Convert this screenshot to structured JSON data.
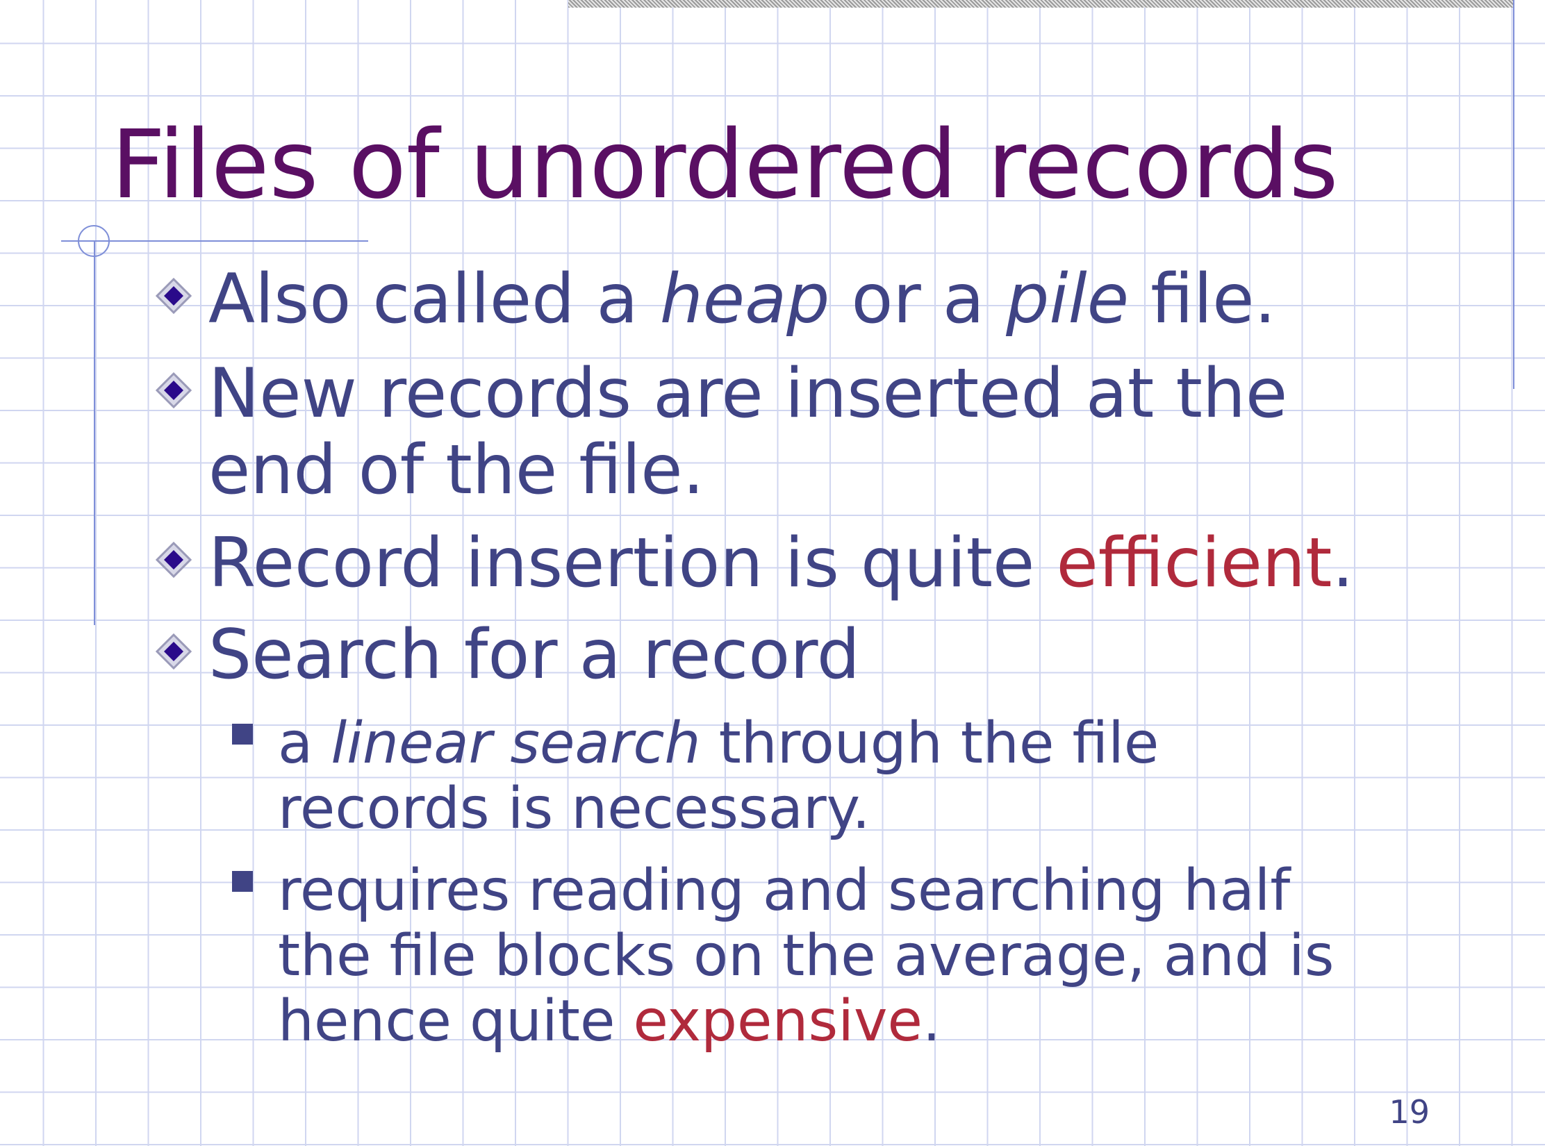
{
  "title": "Files of unordered records",
  "page_number": "19",
  "colors": {
    "title": "#5a0f63",
    "body": "#404485",
    "highlight": "#b02a3c",
    "rule": "#7f8fd8"
  },
  "bullets": [
    {
      "a": "Also called a ",
      "b": "heap",
      "c": "  or a ",
      "d": "pile",
      "e": "  file."
    },
    {
      "line1": "New records are inserted at the",
      "line2": "end of the file."
    },
    {
      "a": "Record insertion is quite ",
      "hl": "efficient",
      "e": "."
    },
    {
      "text": "Search for a record"
    }
  ],
  "subbullets": [
    {
      "a": "a ",
      "b": "linear search",
      "c": "  through the file",
      "line2": "records is necessary."
    },
    {
      "line1": "requires reading and searching half",
      "line2": "the file blocks on the average, and is",
      "line3a": "hence quite ",
      "hl": "expensive",
      "line3b": "."
    }
  ]
}
